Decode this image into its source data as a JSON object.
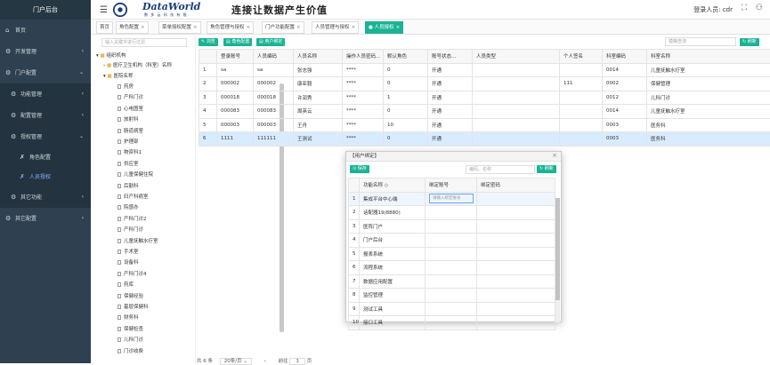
{
  "sidebar": {
    "title": "门户后台",
    "items": [
      {
        "label": "首页",
        "icon": "home-icon"
      },
      {
        "label": "开发管理",
        "icon": "gear-icon"
      },
      {
        "label": "门户配置",
        "icon": "gear-icon"
      }
    ],
    "sub": [
      {
        "label": "功能管理"
      },
      {
        "label": "配置管理"
      },
      {
        "label": "授权管理"
      }
    ],
    "sub2": [
      {
        "label": "角色配置"
      },
      {
        "label": "人员授权"
      }
    ],
    "after": [
      {
        "label": "其它功能"
      },
      {
        "label": "其它配置"
      }
    ]
  },
  "header": {
    "brand": "DataWorld",
    "brand_sub": "数 多 云 科 技 有 限",
    "slogan": "连接让数据产生价值",
    "user": "登录人员: cdr"
  },
  "tabs": [
    "首页",
    "角色配置",
    "菜单授权配置",
    "角色管理与授权",
    "门户功能配置",
    "人员管理与授权",
    "● 人员授权"
  ],
  "tree": {
    "search_placeholder": "输入关键字进行过滤",
    "root": "组织机构",
    "org": "医疗卫生机构（科室）名称",
    "hosp": "医院名称",
    "nodes": [
      "药房",
      "产科门诊",
      "心电图室",
      "放射科",
      "肠道病室",
      "护理部",
      "物资科1",
      "供应室",
      "儿童保健住院",
      "后勤科",
      "妇产科病室",
      "院感办",
      "产科门诊2",
      "产科门诊",
      "儿童抚触水疗室",
      "手术室",
      "设备科",
      "产科门诊4",
      "药库",
      "保健经验",
      "基层保健科",
      "财务科",
      "保健检查",
      "儿科门诊",
      "门诊收费"
    ]
  },
  "toolbar": {
    "btn1": "浏览",
    "btn2": "角色配置",
    "btn3": "用户绑定",
    "search_placeholder": "模糊查询",
    "refresh": "刷新"
  },
  "table": {
    "headers": [
      "",
      "登录账号",
      "人员编码",
      "人员名称",
      "操作人员密码...",
      "默认角色",
      "账号状态...",
      "人员类型",
      "个人签名",
      "科室编码",
      "科室名称"
    ],
    "rows": [
      [
        "1",
        "sa",
        "sa",
        "张志强",
        "****",
        "0",
        "开通",
        "",
        "",
        "0014",
        "儿童抚触水疗室"
      ],
      [
        "2",
        "000002",
        "000002",
        "康亚毅",
        "****",
        "0",
        "开通",
        "",
        "111",
        "0002",
        "保健管理"
      ],
      [
        "3",
        "000018",
        "000018",
        "许润秀",
        "****",
        "1",
        "开通",
        "",
        "",
        "0012",
        "儿科门诊"
      ],
      [
        "4",
        "000083",
        "000083",
        "周英云",
        "****",
        "0",
        "开通",
        "",
        "",
        "0014",
        "儿童抚触水疗室"
      ],
      [
        "5",
        "000003",
        "000003",
        "王舟",
        "****",
        "10",
        "开通",
        "",
        "",
        "0003",
        "医务科"
      ],
      [
        "6",
        "1111",
        "111111",
        "王测试",
        "****",
        "0",
        "开通",
        "",
        "",
        "0003",
        "医务科"
      ]
    ],
    "selected_row": 5
  },
  "pager": {
    "text": "共 6 条",
    "per_page": "20条/页",
    "goto": "前往",
    "page": "1",
    "unit": "页"
  },
  "dialog": {
    "title": "【用户绑定】",
    "save": "保存",
    "search_placeholder": "编码、名称",
    "refresh": "刷新",
    "headers": [
      "",
      "功能名称",
      "绑定账号",
      "绑定密码"
    ],
    "input_placeholder": "请输入绑定账号",
    "rows": [
      [
        "1",
        "集成平台中心端"
      ],
      [
        "2",
        "话配器19(8880)"
      ],
      [
        "3",
        "医阵门户"
      ],
      [
        "4",
        "门户后台"
      ],
      [
        "5",
        "报表系统"
      ],
      [
        "6",
        "流程系统"
      ],
      [
        "7",
        "数据应用配置"
      ],
      [
        "8",
        "监控管理"
      ],
      [
        "9",
        "测试工具"
      ],
      [
        "10",
        "接口工具"
      ]
    ]
  }
}
